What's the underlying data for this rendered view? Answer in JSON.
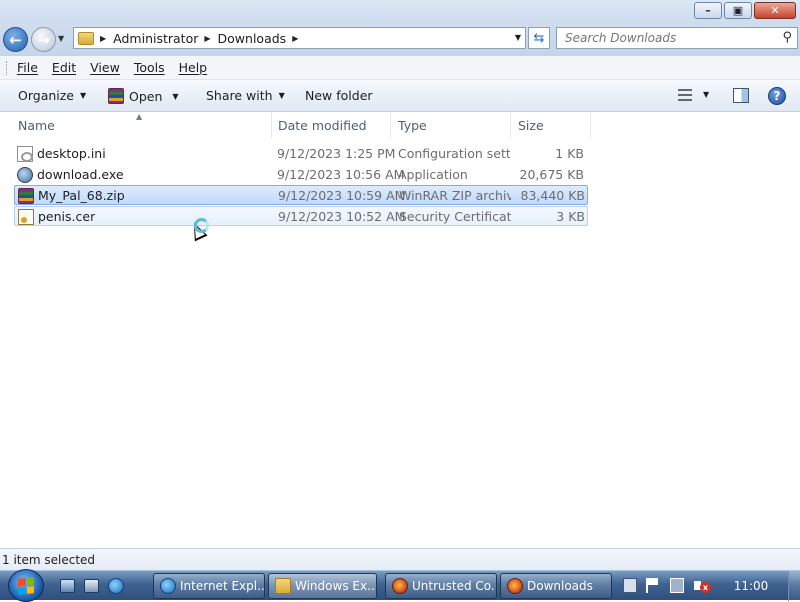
{
  "window": {
    "minimize_glyph": "–",
    "maximize_glyph": "▣",
    "close_glyph": "✕"
  },
  "address": {
    "crumbs": [
      "Administrator",
      "Downloads"
    ],
    "refresh_glyph": "⇆",
    "search_placeholder": "Search Downloads"
  },
  "menu": {
    "items": [
      "File",
      "Edit",
      "View",
      "Tools",
      "Help"
    ]
  },
  "commands": {
    "organize": "Organize",
    "open": "Open",
    "share_with": "Share with",
    "new_folder": "New folder",
    "help_glyph": "?"
  },
  "columns": {
    "name": "Name",
    "date_modified": "Date modified",
    "type": "Type",
    "size": "Size"
  },
  "files": [
    {
      "name": "desktop.ini",
      "date": "9/12/2023 1:25 PM",
      "type": "Configuration sett...",
      "size": "1 KB",
      "icon": "settings-file-icon"
    },
    {
      "name": "download.exe",
      "date": "9/12/2023 10:56 AM",
      "type": "Application",
      "size": "20,675 KB",
      "icon": "application-icon"
    },
    {
      "name": "My_Pal_68.zip",
      "date": "9/12/2023 10:59 AM",
      "type": "WinRAR ZIP archive",
      "size": "83,440 KB",
      "icon": "winrar-archive-icon"
    },
    {
      "name": "penis.cer",
      "date": "9/12/2023 10:52 AM",
      "type": "Security Certificate",
      "size": "3 KB",
      "icon": "certificate-icon"
    }
  ],
  "status": {
    "text": "1 item selected"
  },
  "taskbar": {
    "tasks": [
      {
        "label": "Internet Expl...",
        "icon": "internet-explorer-icon"
      },
      {
        "label": "Windows Ex...",
        "icon": "windows-explorer-icon"
      },
      {
        "label": "Untrusted Co...",
        "icon": "firefox-icon"
      },
      {
        "label": "Downloads",
        "icon": "firefox-icon"
      }
    ],
    "clock": "11:00"
  },
  "colors": {
    "selection": "#c1dbfc",
    "taskbar": "#3f6290",
    "chrome": "#cddbee"
  }
}
